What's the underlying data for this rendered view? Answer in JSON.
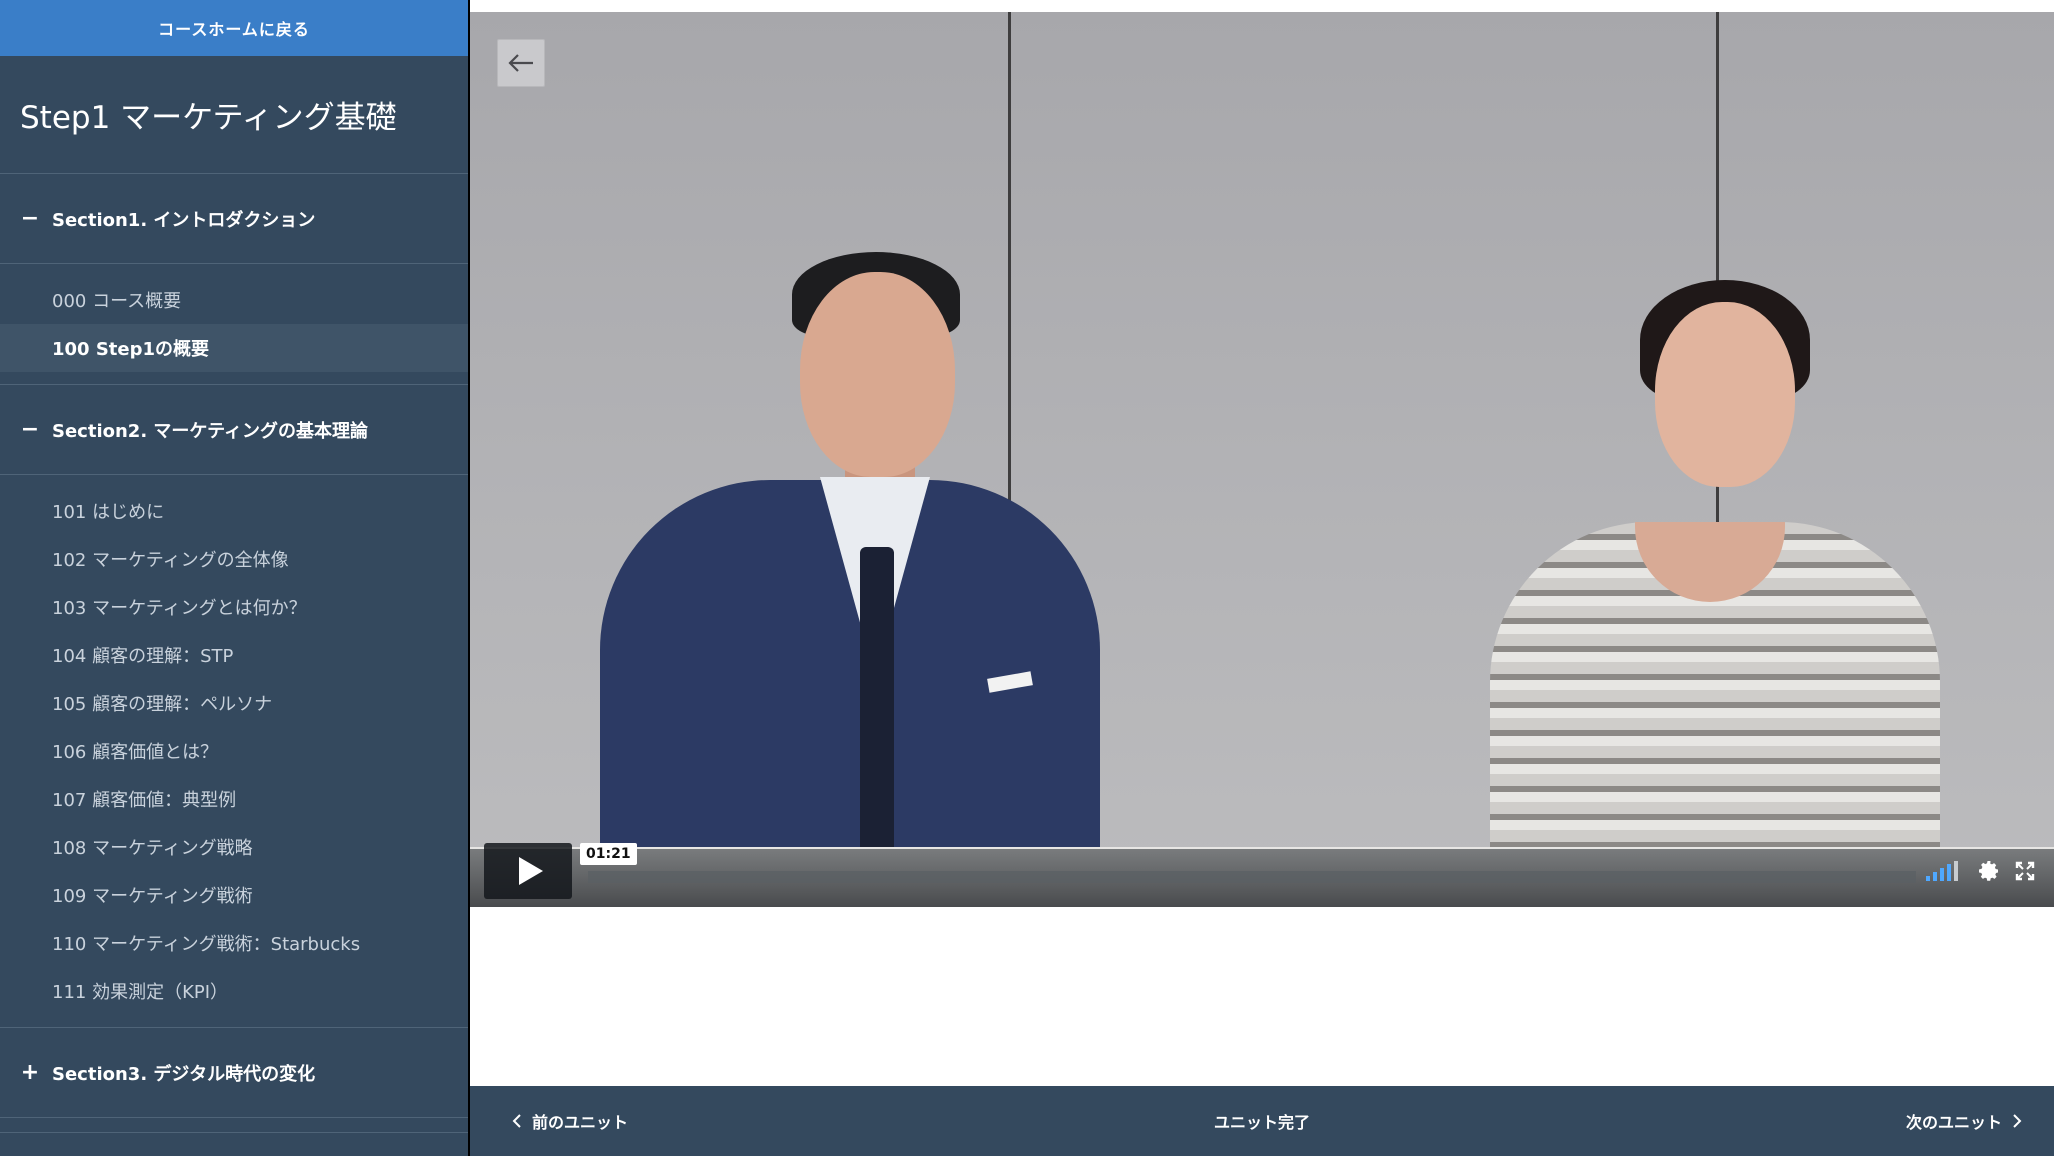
{
  "sidebar": {
    "back_home": "コースホームに戻る",
    "course_title": "Step1 マーケティング基礎",
    "sections": [
      {
        "toggle": "−",
        "title": "Section1. イントロダクション",
        "units": [
          "000 コース概要",
          "100 Step1の概要"
        ]
      },
      {
        "toggle": "−",
        "title": "Section2. マーケティングの基本理論",
        "units": [
          "101 はじめに",
          "102 マーケティングの全体像",
          "103 マーケティングとは何か？",
          "104 顧客の理解：STP",
          "105 顧客の理解：ペルソナ",
          "106 顧客価値とは？",
          "107 顧客価値：典型例",
          "108 マーケティング戦略",
          "109 マーケティング戦術",
          "110 マーケティング戦術：Starbucks",
          "111 効果測定（KPI）"
        ]
      },
      {
        "toggle": "+",
        "title": "Section3. デジタル時代の変化"
      }
    ],
    "active_unit": "100 Step1の概要"
  },
  "player": {
    "time_tooltip": "01:21",
    "icons": {
      "back": "arrow-left-icon",
      "play": "play-icon",
      "volume": "volume-icon",
      "settings": "gear-icon",
      "fullscreen": "fullscreen-icon"
    },
    "accent_color": "#4fa8ff"
  },
  "footer": {
    "prev": "前のユニット",
    "complete": "ユニット完了",
    "next": "次のユニット"
  },
  "colors": {
    "sidebar_bg": "#34495e",
    "back_home_bg": "#3a7ec8"
  }
}
